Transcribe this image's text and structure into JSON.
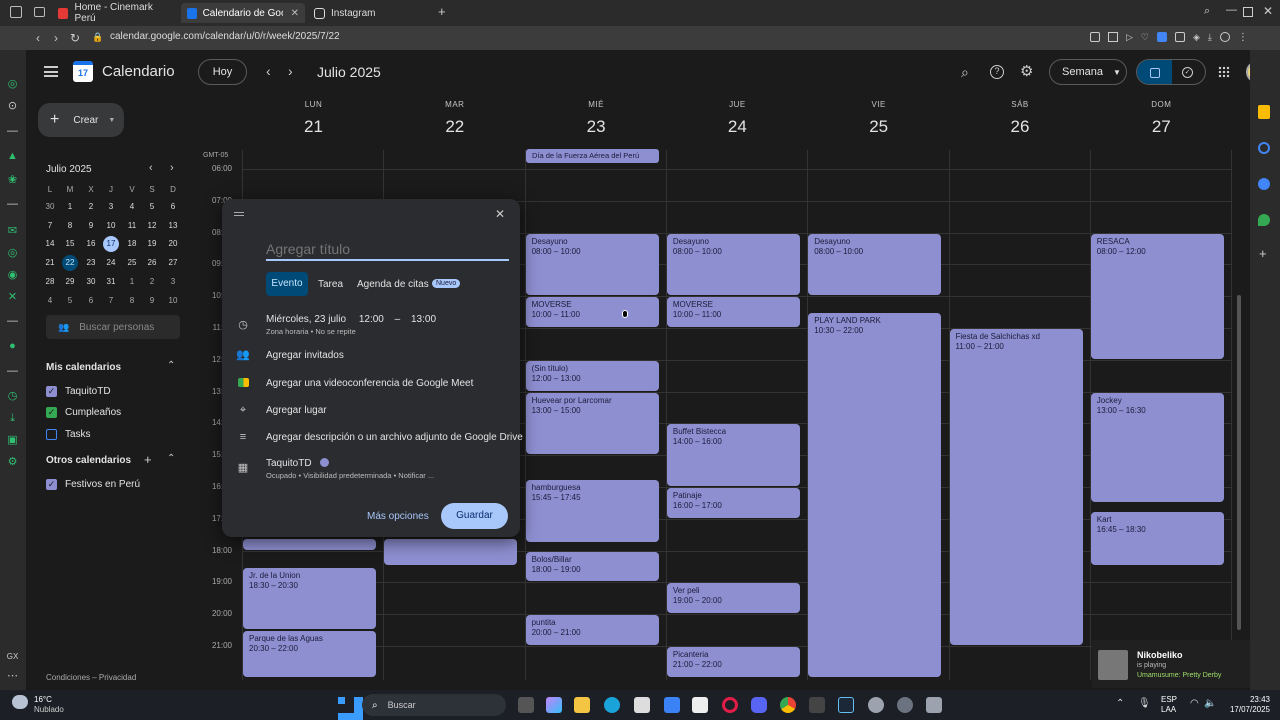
{
  "browser": {
    "tabs": [
      {
        "label": "Home - Cinemark Perú",
        "color": "#e53935"
      },
      {
        "label": "Calendario de Google - ",
        "color": "#1a73e8"
      },
      {
        "label": "Instagram",
        "color": "#ddd"
      }
    ],
    "url": "calendar.google.com/calendar/u/0/r/week/2025/7/22"
  },
  "header": {
    "app_name": "Calendario",
    "logo_day": "17",
    "today_btn": "Hoy",
    "month_title": "Julio 2025",
    "view_btn": "Semana"
  },
  "sidebar": {
    "create_label": "Crear",
    "mini_month": "Julio 2025",
    "dow": [
      "L",
      "M",
      "X",
      "J",
      "V",
      "S",
      "D"
    ],
    "weeks": [
      [
        "30",
        "1",
        "2",
        "3",
        "4",
        "5",
        "6"
      ],
      [
        "7",
        "8",
        "9",
        "10",
        "11",
        "12",
        "13"
      ],
      [
        "14",
        "15",
        "16",
        "17",
        "18",
        "19",
        "20"
      ],
      [
        "21",
        "22",
        "23",
        "24",
        "25",
        "26",
        "27"
      ],
      [
        "28",
        "29",
        "30",
        "31",
        "1",
        "2",
        "3"
      ],
      [
        "4",
        "5",
        "6",
        "7",
        "8",
        "9",
        "10"
      ]
    ],
    "search_people": "Buscar personas",
    "my_calendars_title": "Mis calendarios",
    "my_calendars": [
      {
        "label": "TaquitoTD",
        "color": "#8e8fd1",
        "checked": true
      },
      {
        "label": "Cumpleaños",
        "color": "#34a853",
        "checked": true
      },
      {
        "label": "Tasks",
        "color": "#4285f4",
        "checked": false
      }
    ],
    "other_calendars_title": "Otros calendarios",
    "other_calendars": [
      {
        "label": "Festivos en Perú",
        "color": "#8e8fd1",
        "checked": true
      }
    ],
    "footer": "Condiciones – Privacidad"
  },
  "week": {
    "timezone": "GMT-05",
    "days": [
      {
        "dow": "LUN",
        "num": "21"
      },
      {
        "dow": "MAR",
        "num": "22"
      },
      {
        "dow": "MIÉ",
        "num": "23"
      },
      {
        "dow": "JUE",
        "num": "24"
      },
      {
        "dow": "VIE",
        "num": "25"
      },
      {
        "dow": "SÁB",
        "num": "26"
      },
      {
        "dow": "DOM",
        "num": "27"
      }
    ],
    "hours": [
      "06:00",
      "07:00",
      "08:00",
      "09:00",
      "10:00",
      "11:00",
      "12:00",
      "13:00",
      "14:00",
      "15:00",
      "16:00",
      "17:00",
      "18:00",
      "19:00",
      "20:00",
      "21:00"
    ],
    "allday": {
      "title": "Día de la Fuerza Aérea del Perú"
    },
    "events": [
      {
        "day": 2,
        "title": "Desayuno",
        "time": "08:00 – 10:00",
        "start": 8,
        "end": 10
      },
      {
        "day": 2,
        "title": "MOVERSE",
        "time": "10:00 – 11:00",
        "start": 10,
        "end": 11
      },
      {
        "day": 2,
        "title": "(Sin título)",
        "time": "12:00 – 13:00",
        "start": 12,
        "end": 13
      },
      {
        "day": 2,
        "title": "Huevear por Larcomar",
        "time": "13:00 – 15:00",
        "start": 13,
        "end": 15
      },
      {
        "day": 2,
        "title": "hamburguesa",
        "time": "15:45 – 17:45",
        "start": 15.75,
        "end": 17.75
      },
      {
        "day": 2,
        "title": "Bolos/Billar",
        "time": "18:00 – 19:00",
        "start": 18,
        "end": 19
      },
      {
        "day": 2,
        "title": "puntita",
        "time": "20:00 – 21:00",
        "start": 20,
        "end": 21
      },
      {
        "day": 3,
        "title": "Desayuno",
        "time": "08:00 – 10:00",
        "start": 8,
        "end": 10
      },
      {
        "day": 3,
        "title": "MOVERSE",
        "time": "10:00 – 11:00",
        "start": 10,
        "end": 11
      },
      {
        "day": 3,
        "title": "Buffet Bistecca",
        "time": "14:00 – 16:00",
        "start": 14,
        "end": 16
      },
      {
        "day": 3,
        "title": "Patinaje",
        "time": "16:00 – 17:00",
        "start": 16,
        "end": 17
      },
      {
        "day": 3,
        "title": "Ver peli",
        "time": "19:00 – 20:00",
        "start": 19,
        "end": 20
      },
      {
        "day": 3,
        "title": "Picanteria",
        "time": "21:00 – 22:00",
        "start": 21,
        "end": 22
      },
      {
        "day": 4,
        "title": "Desayuno",
        "time": "08:00 – 10:00",
        "start": 8,
        "end": 10
      },
      {
        "day": 4,
        "title": "PLAY LAND PARK",
        "time": "10:30 – 22:00",
        "start": 10.5,
        "end": 22
      },
      {
        "day": 5,
        "title": "Fiesta de Salchichas xd",
        "time": "11:00 – 21:00",
        "start": 11,
        "end": 21
      },
      {
        "day": 6,
        "title": "RESACA",
        "time": "08:00 – 12:00",
        "start": 8,
        "end": 12
      },
      {
        "day": 6,
        "title": "Jockey",
        "time": "13:00 – 16:30",
        "start": 13,
        "end": 16.5
      },
      {
        "day": 6,
        "title": "Kart",
        "time": "16:45 – 18:30",
        "start": 16.75,
        "end": 18.5
      },
      {
        "day": 0,
        "title": "Jr. de la Union",
        "time": "18:30 – 20:30",
        "start": 18.5,
        "end": 20.5
      },
      {
        "day": 0,
        "title": "Parque de las Aguas",
        "time": "20:30 – 22:00",
        "start": 20.5,
        "end": 22
      },
      {
        "day": 0,
        "title": "",
        "time": "",
        "start": 17.6,
        "end": 18
      },
      {
        "day": 1,
        "title": "",
        "time": "",
        "start": 17.6,
        "end": 18.5
      }
    ]
  },
  "dialog": {
    "title_placeholder": "Agregar título",
    "tabs": [
      "Evento",
      "Tarea",
      "Agenda de citas"
    ],
    "new_badge": "Nuevo",
    "date": "Miércoles, 23 julio",
    "start": "12:00",
    "dash": "–",
    "end": "13:00",
    "timezone_note": "Zona horaria • No se repite",
    "guests": "Agregar invitados",
    "meet": "Agregar una videoconferencia de Google Meet",
    "location": "Agregar lugar",
    "description": "Agregar descripción o un archivo adjunto de Google Drive",
    "calendar": "TaquitoTD",
    "calendar_note": "Ocupado • Visibilidad predeterminada • Notificar ...",
    "more_options": "Más opciones",
    "save": "Guardar"
  },
  "notification": {
    "name": "Nikobeliko",
    "status": "is playing",
    "game": "Umamusume: Pretty Derby"
  },
  "taskbar": {
    "weather_temp": "16°C",
    "weather_desc": "Nublado",
    "search": "Buscar",
    "lang1": "ESP",
    "lang2": "LAA",
    "time": "23:43",
    "date": "17/07/2025"
  }
}
